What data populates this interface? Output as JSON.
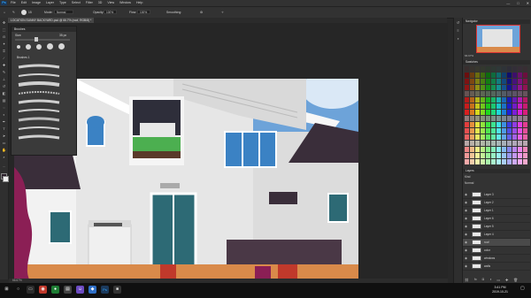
{
  "app": {
    "logo": "Ps",
    "brand_color": "#31a8ff"
  },
  "menu": [
    "File",
    "Edit",
    "Image",
    "Layer",
    "Type",
    "Select",
    "Filter",
    "3D",
    "View",
    "Window",
    "Help"
  ],
  "window_controls": {
    "minimize": "—",
    "maximize": "□",
    "close": "✕"
  },
  "options": {
    "brush_size": "15",
    "mode_label": "Mode:",
    "mode_value": "Normal",
    "opacity_label": "Opacity:",
    "opacity_value": "100%",
    "flow_label": "Flow:",
    "flow_value": "100%",
    "smoothing_label": "Smoothing:"
  },
  "document_tab": "LOCATION SUNNY BACKYARD.psd @ 66.7% (roof, RGB/8) *",
  "brushes_panel": {
    "title": "Brushes",
    "size_label": "Size:",
    "size_value": "35 px",
    "folder": "Brushes 1"
  },
  "status_bar": {
    "zoom": "66.67%"
  },
  "navigator": {
    "title": "Navigator",
    "zoom": "66.67%"
  },
  "swatches_title": "Swatches",
  "layers": {
    "title": "Layers",
    "kind_label": "Kind",
    "blend_mode": "Normal",
    "items": [
      {
        "name": "Layer 3"
      },
      {
        "name": "Layer 2"
      },
      {
        "name": "Layer 1"
      },
      {
        "name": "Layer 6"
      },
      {
        "name": "Layer 5"
      },
      {
        "name": "Layer 4"
      },
      {
        "name": "roof"
      },
      {
        "name": "color"
      },
      {
        "name": "windows"
      },
      {
        "name": "walls"
      }
    ]
  },
  "taskbar": {
    "time": "3:41 PM",
    "date": "2019-10-21"
  },
  "colors": {
    "sky": "#6da3d9",
    "wall": "#e6e6e6",
    "roof": "#3a2e3a",
    "window": "#3b82c4",
    "ground": "#d98a4a"
  }
}
